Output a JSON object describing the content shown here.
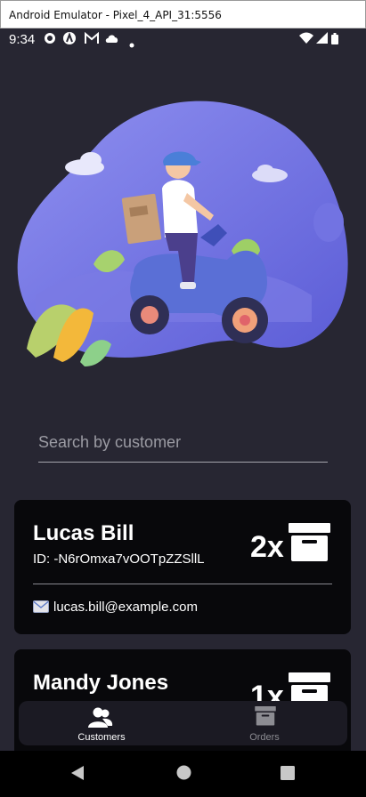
{
  "window": {
    "title": "Android Emulator - Pixel_4_API_31:5556"
  },
  "status_bar": {
    "time": "9:34",
    "left_icons": [
      "gear-icon",
      "a-circle-icon",
      "gmail-icon",
      "cloud-icon",
      "dot-icon"
    ],
    "right_icons": [
      "wifi-icon",
      "signal-icon",
      "battery-icon"
    ]
  },
  "search": {
    "placeholder": "Search by customer",
    "value": ""
  },
  "customers": [
    {
      "name": "Lucas Bill",
      "id_text": "ID: -N6rOmxa7vOOTpZZSllL",
      "order_count": "2x",
      "email": "lucas.bill@example.com"
    },
    {
      "name": "Mandy Jones",
      "order_count": "1x"
    }
  ],
  "bottom_nav": {
    "items": [
      {
        "label": "Customers",
        "icon": "customers-icon",
        "active": true
      },
      {
        "label": "Orders",
        "icon": "orders-box-icon",
        "active": false
      }
    ]
  },
  "system_nav": [
    "back-icon",
    "home-icon",
    "recents-icon"
  ],
  "colors": {
    "background": "#272632",
    "card": "#08080b",
    "nav_bar": "#1b1a23",
    "active_nav": "#ffffff",
    "inactive_nav": "#8c8c92",
    "illustration_blob": "#6d6ee0"
  }
}
